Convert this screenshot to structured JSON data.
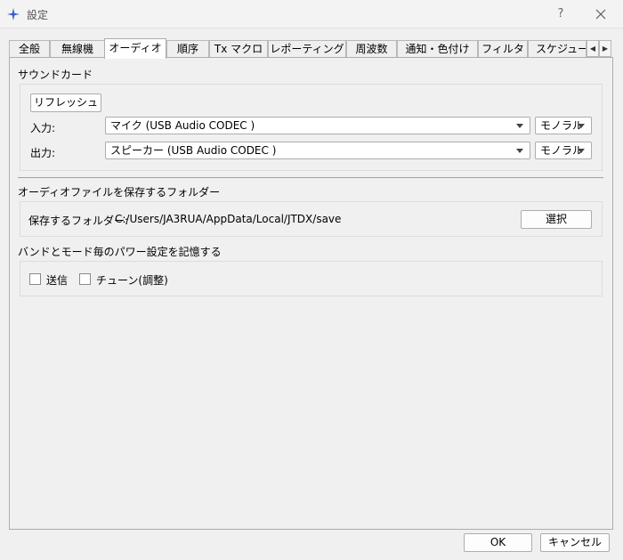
{
  "window": {
    "title": "設定",
    "help": "?"
  },
  "tabs": [
    "全般",
    "無線機",
    "オーディオ",
    "順序",
    "Tx マクロ",
    "レポーティング",
    "周波数",
    "通知・色付け",
    "フィルタ",
    "スケジューラ"
  ],
  "soundcard": {
    "group_title": "サウンドカード",
    "refresh_label": "リフレッシュ",
    "input_label": "入力:",
    "input_device": "マイク (USB Audio CODEC )",
    "input_channel": "モノラル",
    "output_label": "出力:",
    "output_device": "スピーカー (USB Audio CODEC )",
    "output_channel": "モノラル"
  },
  "save_folder": {
    "group_title": "オーディオファイルを保存するフォルダー",
    "label": "保存するフォルダー:",
    "path": "C:/Users/JA3RUA/AppData/Local/JTDX/save",
    "select_label": "選択"
  },
  "power_memory": {
    "group_title": "バンドとモード毎のパワー設定を記憶する",
    "transmit_label": "送信",
    "transmit_checked": false,
    "tune_label": "チューン(調整)",
    "tune_checked": false
  },
  "footer": {
    "ok_label": "OK",
    "cancel_label": "キャンセル"
  }
}
